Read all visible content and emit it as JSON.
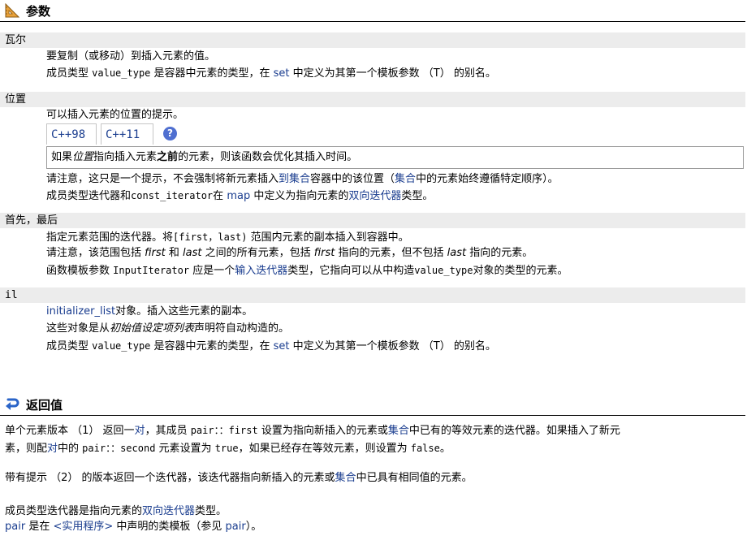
{
  "params_section": {
    "title": "参数",
    "icon": "ruler-triangle-icon",
    "items": [
      {
        "name": "瓦尔"
      },
      {
        "name": "位置"
      },
      {
        "name": "首先，最后"
      },
      {
        "name": "il"
      }
    ]
  },
  "val": {
    "l1": "要复制（或移动）到插入元素的值。",
    "l2_a": "成员类型 ",
    "l2_code": "value_type",
    "l2_b": " 是容器中元素的类型，在 ",
    "l2_link": "set",
    "l2_c": " 中定义为其第一个模板参数 （T） 的别名。"
  },
  "position": {
    "l1": "可以插入元素的位置的提示。",
    "tab1": "C++98",
    "tab2": "C++11",
    "help": "?",
    "note_a": "如果",
    "note_em": "位置",
    "note_b": "指向插入元素",
    "note_strong": "之前",
    "note_c": "的元素，则该函数会优化其插入时间。",
    "l3_a": "请注意，这只是一个提示，不会强制将新元素插入",
    "l3_link1": "到集合",
    "l3_b": "容器中的该位置（",
    "l3_link2": "集合",
    "l3_c": "中的元素始终遵循特定顺序）。",
    "l4_a": "成员类型迭代器和",
    "l4_code": "const_iterator",
    "l4_b": "在 ",
    "l4_link1": "map",
    "l4_c": " 中定义为指向元素的",
    "l4_link2": "双向迭代器",
    "l4_d": "类型。"
  },
  "first_last": {
    "l1_a": "指定元素范围的迭代器。将",
    "l1_code": "[first，last)",
    "l1_b": " 范围内元素的副本插入到容器中。",
    "l2_a": "请注意，该范围包括 ",
    "l2_em1": "first",
    "l2_b": " 和 ",
    "l2_em2": "last",
    "l2_c": " 之间的所有元素，包括 ",
    "l2_em3": "first",
    "l2_d": " 指向的元素，但不包括 ",
    "l2_em4": "last",
    "l2_e": " 指向的元素。",
    "l3_a": "函数模板参数 ",
    "l3_code": "InputIterator",
    "l3_b": " 应是一个",
    "l3_link": "输入迭代器",
    "l3_c": "类型，它指向可以从中构造",
    "l3_code2": "value_type",
    "l3_d": "对象的类型的元素。"
  },
  "il": {
    "l1_link": "initializer_list",
    "l1_a": "对象。插入这些元素的副本。",
    "l2_a": "这些对象是从",
    "l2_em": "初始值设定项列表",
    "l2_b": "声明符自动构造的。",
    "l3_a": "成员类型 ",
    "l3_code": "value_type",
    "l3_b": " 是容器中元素的类型，在 ",
    "l3_link": "set",
    "l3_c": " 中定义为其第一个模板参数 （T） 的别名。"
  },
  "return_section": {
    "title": "返回值",
    "icon": "return-arrow-icon",
    "p1_l1_a": "单个元素版本 （1） 返回一",
    "p1_l1_link1": "对",
    "p1_l1_b": "，其成员 ",
    "p1_l1_code1": "pair：：first",
    "p1_l1_c": " 设置为指向新插入的元素或",
    "p1_l1_link2": "集合",
    "p1_l1_d": "中已有的等效元素的迭代器。如果插入了新元",
    "p1_l2_a": "素，则配",
    "p1_l2_link": "对",
    "p1_l2_b": "中的 ",
    "p1_l2_code1": "pair：：second",
    "p1_l2_c": " 元素设置为 ",
    "p1_l2_code2": "true",
    "p1_l2_d": "，如果已经存在等效元素，则设置为 ",
    "p1_l2_code3": "false",
    "p1_l2_e": "。",
    "p2_a": "带有提示 （2） 的版本返回一个迭代器，该迭代器指向新插入的元素或",
    "p2_link": "集合",
    "p2_b": "中已具有相同值的元素。",
    "p3_a": "成员类型迭代器是指向元素的",
    "p3_link": "双向迭代器",
    "p3_b": "类型。",
    "p4_link1": "pair",
    "p4_a": " 是在 ",
    "p4_link2": "<实用程序>",
    "p4_b": " 中声明的类模板（参见 ",
    "p4_link3": "pair",
    "p4_c": "）。"
  }
}
